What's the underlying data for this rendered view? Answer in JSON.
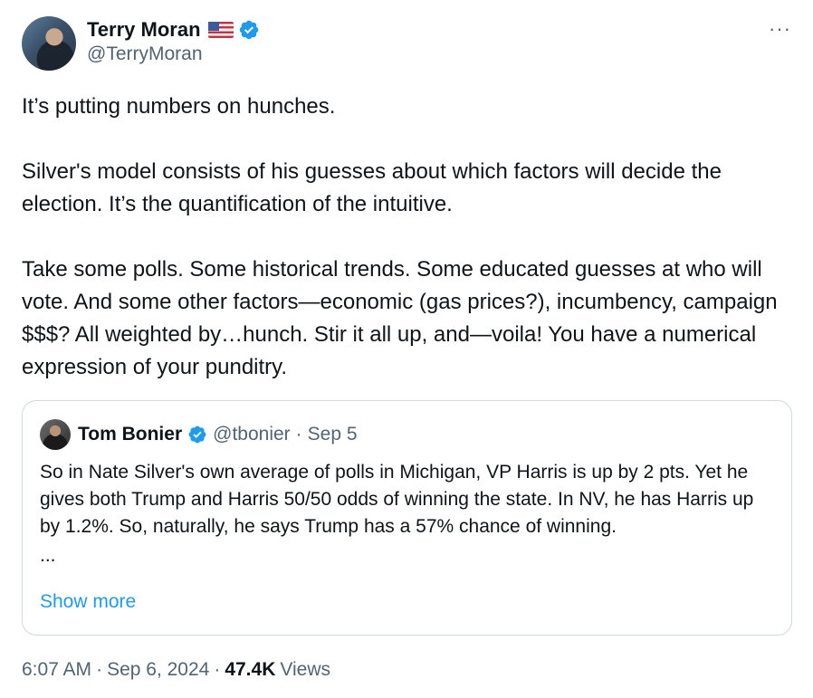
{
  "author": {
    "display_name": "Terry Moran",
    "handle": "@TerryMoran"
  },
  "more_icon": "···",
  "tweet": {
    "paragraphs": [
      "It’s putting numbers on hunches.",
      "Silver's model consists of his guesses about which factors will decide the election.  It’s the quantification of the intuitive.",
      "Take some polls. Some historical trends. Some educated guesses at who will vote. And some other factors—economic (gas prices?), incumbency, campaign $$$?  All weighted by…hunch.  Stir it all up, and—voila! You have a numerical expression of your punditry."
    ]
  },
  "quote": {
    "display_name": "Tom Bonier",
    "handle": "@tbonier",
    "date": "Sep 5",
    "text": "So in Nate Silver's own average of polls in Michigan, VP Harris is up by 2 pts. Yet he gives both Trump and Harris 50/50 odds of winning the state. In NV, he has Harris up by 1.2%. So, naturally, he says Trump has a 57% chance of winning.",
    "ellipsis": "...",
    "show_more": "Show more"
  },
  "meta": {
    "time": "6:07 AM",
    "date": "Sep 6, 2024",
    "views_count": "47.4K",
    "views_label": "Views",
    "separator": "·"
  },
  "colors": {
    "verified_blue": "#1d9bf0",
    "secondary_text": "#536471",
    "border": "#cfd9de"
  }
}
